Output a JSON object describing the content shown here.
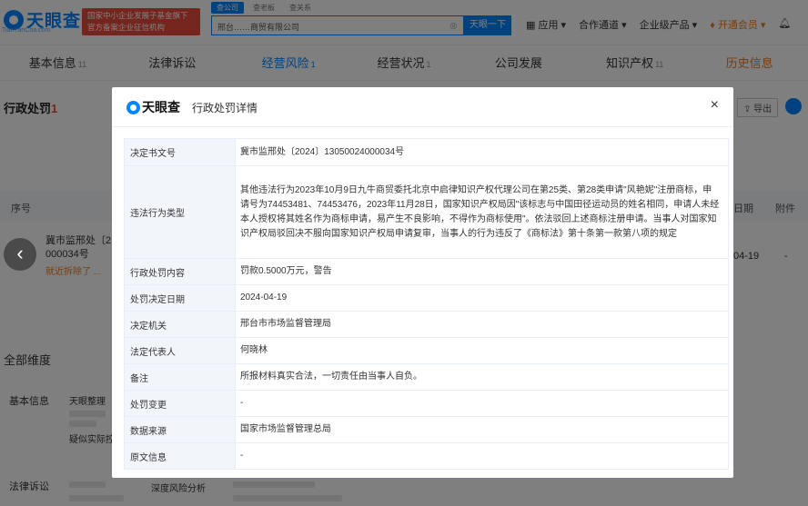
{
  "header": {
    "logo_text": "天眼查",
    "logo_sub": "TianYanCha.com",
    "red_badge": "国家中小企业发展子基金旗下 官方备案企业征信机构",
    "search_tabs": [
      "查公司",
      "查老板",
      "查关系"
    ],
    "search_value": "邢台……商贸有限公司",
    "search_button": "天眼一下",
    "nav": [
      "应用",
      "合作通道",
      "企业级产品",
      "开通会员"
    ]
  },
  "tabs": [
    {
      "label": "基本信息",
      "count": "11"
    },
    {
      "label": "法律诉讼",
      "count": ""
    },
    {
      "label": "经营风险",
      "count": "1"
    },
    {
      "label": "经营状况",
      "count": "1"
    },
    {
      "label": "公司发展",
      "count": ""
    },
    {
      "label": "知识产权",
      "count": "11"
    },
    {
      "label": "历史信息",
      "count": ""
    }
  ],
  "section": {
    "title": "行政处罚",
    "count": "1",
    "export": "导出"
  },
  "table": {
    "headers": [
      "序号",
      "日期",
      "附件"
    ],
    "row": {
      "decision_no": "冀市监邢处〔2",
      "decision_no_tail": "000034号",
      "link": "就近拆除了 ...",
      "date": "04-19",
      "attachment": "-"
    }
  },
  "bottom": {
    "all_dimensions": "全部维度",
    "basic_info": "基本信息",
    "basic_sub1": "天眼整理",
    "basic_sub2": "疑似实际控",
    "legal": "法律诉讼",
    "legal_sub": "深度风险分析"
  },
  "carousel": {
    "prev_glyph": "‹"
  },
  "modal": {
    "logo_text": "天眼查",
    "title": "行政处罚详情",
    "close_glyph": "×",
    "rows": [
      {
        "label": "决定书文号",
        "value": "冀市监邢处〔2024〕13050024000034号"
      },
      {
        "label": "违法行为类型",
        "value": "其他违法行为2023年10月9日九牛商贸委托北京中启律知识产权代理公司在第25类、第28类申请\"风艳妮\"注册商标，申请号为74453481、74453476，2023年11月28日，国家知识产权局因\"该标志与中国田径运动员的姓名相同，申请人未经本人授权将其姓名作为商标申请，易产生不良影响，不得作为商标使用\"。依法驳回上述商标注册申请。当事人对国家知识产权局驳回决不服向国家知识产权局申请复审，当事人的行为违反了《商标法》第十条第一款第八项的规定"
      },
      {
        "label": "行政处罚内容",
        "value": "罚款0.5000万元，警告"
      },
      {
        "label": "处罚决定日期",
        "value": "2024-04-19"
      },
      {
        "label": "决定机关",
        "value": "邢台市市场监督管理局"
      },
      {
        "label": "法定代表人",
        "value": "何晓林"
      },
      {
        "label": "备注",
        "value": "所报材料真实合法，一切责任由当事人自负。"
      },
      {
        "label": "处罚变更",
        "value": "-"
      },
      {
        "label": "数据来源",
        "value": "国家市场监督管理总局"
      },
      {
        "label": "原文信息",
        "value": "-"
      }
    ]
  }
}
